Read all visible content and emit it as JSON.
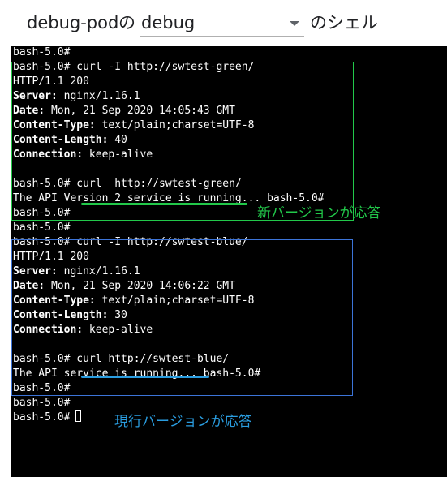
{
  "header": {
    "pod_name": "debug-pod",
    "particle_no": "の",
    "container_select": {
      "value": "debug"
    },
    "suffix": "のシェル"
  },
  "terminal": {
    "lines": [
      [
        {
          "t": "bash-5.0#"
        }
      ],
      [
        {
          "t": "bash-5.0# curl -I http://swtest-green/"
        }
      ],
      [
        {
          "t": "HTTP/1.1 200"
        }
      ],
      [
        {
          "t": "Server:",
          "b": true
        },
        {
          "t": " nginx/1.16.1"
        }
      ],
      [
        {
          "t": "Date:",
          "b": true
        },
        {
          "t": " Mon, 21 Sep 2020 14:05:43 GMT"
        }
      ],
      [
        {
          "t": "Content-Type:",
          "b": true
        },
        {
          "t": " text/plain;charset=UTF-8"
        }
      ],
      [
        {
          "t": "Content-Length:",
          "b": true
        },
        {
          "t": " 40"
        }
      ],
      [
        {
          "t": "Connection:",
          "b": true
        },
        {
          "t": " keep-alive"
        }
      ],
      [
        {
          "t": ""
        }
      ],
      [
        {
          "t": "bash-5.0# curl  http://swtest-green/"
        }
      ],
      [
        {
          "t": "The API Version 2 service is running... bash-5.0#"
        }
      ],
      [
        {
          "t": "bash-5.0#"
        }
      ],
      [
        {
          "t": "bash-5.0#"
        }
      ],
      [
        {
          "t": "bash-5.0# curl -I http://swtest-blue/"
        }
      ],
      [
        {
          "t": "HTTP/1.1 200"
        }
      ],
      [
        {
          "t": "Server:",
          "b": true
        },
        {
          "t": " nginx/1.16.1"
        }
      ],
      [
        {
          "t": "Date:",
          "b": true
        },
        {
          "t": " Mon, 21 Sep 2020 14:06:22 GMT"
        }
      ],
      [
        {
          "t": "Content-Type:",
          "b": true
        },
        {
          "t": " text/plain;charset=UTF-8"
        }
      ],
      [
        {
          "t": "Content-Length:",
          "b": true
        },
        {
          "t": " 30"
        }
      ],
      [
        {
          "t": "Connection:",
          "b": true
        },
        {
          "t": " keep-alive"
        }
      ],
      [
        {
          "t": ""
        }
      ],
      [
        {
          "t": "bash-5.0# curl http://swtest-blue/"
        }
      ],
      [
        {
          "t": "The API service is running... bash-5.0#"
        }
      ],
      [
        {
          "t": "bash-5.0#"
        }
      ],
      [
        {
          "t": "bash-5.0#"
        }
      ],
      [
        {
          "t": "bash-5.0# "
        }
      ]
    ]
  },
  "annotations": {
    "green_label": "新バージョンが応答",
    "blue_label": "現行バージョンが応答",
    "green_color": "#22c84a",
    "blue_color": "#2a9de0",
    "blue_box_color": "#3c74d8"
  }
}
